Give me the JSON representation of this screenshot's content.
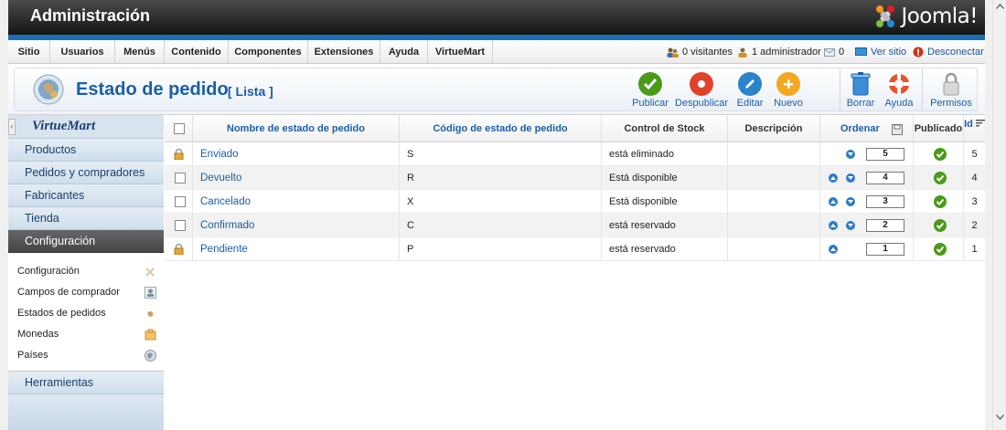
{
  "header": {
    "title": "Administración",
    "brand": "Joomla!",
    "brand_icon": "joomla-logo-icon"
  },
  "menu": {
    "items": [
      "Sitio",
      "Usuarios",
      "Menús",
      "Contenido",
      "Componentes",
      "Extensiones",
      "Ayuda",
      "VirtueMart"
    ]
  },
  "status": {
    "visitors": "0 visitantes",
    "admins": "1 administrador",
    "messages": "0",
    "view_site": "Ver sitio",
    "logout": "Desconectar"
  },
  "page": {
    "title": "Estado de pedido",
    "subtitle": "[ Lista ]"
  },
  "toolbar": {
    "publish": "Publicar",
    "unpublish": "Despublicar",
    "edit": "Editar",
    "new": "Nuevo",
    "delete": "Borrar",
    "help": "Ayuda",
    "permissions": "Permisos"
  },
  "sidebar": {
    "logo_text": "VirtueMart",
    "categories": [
      "Productos",
      "Pedidos y compradores",
      "Fabricantes",
      "Tienda",
      "Configuración"
    ],
    "active_category": "Configuración",
    "subitems": [
      {
        "label": "Configuración",
        "icon": "tools-icon"
      },
      {
        "label": "Campos de comprador",
        "icon": "user-fields-icon"
      },
      {
        "label": "Estados de pedidos",
        "icon": "order-status-icon"
      },
      {
        "label": "Monedas",
        "icon": "currency-icon"
      },
      {
        "label": "Países",
        "icon": "globe-icon"
      }
    ],
    "tools": "Herramientas"
  },
  "table": {
    "headers": {
      "name": "Nombre de estado de pedido",
      "code": "Código de estado de pedido",
      "stock": "Control de Stock",
      "description": "Descripción",
      "order": "Ordenar",
      "published": "Publicado",
      "id": "Id"
    },
    "rows": [
      {
        "name": "Enviado",
        "code": "S",
        "stock": "está eliminado",
        "order": "5",
        "id": "5",
        "locked": true,
        "up": false,
        "down": true
      },
      {
        "name": "Devuelto",
        "code": "R",
        "stock": "Está disponible",
        "order": "4",
        "id": "4",
        "locked": false,
        "up": true,
        "down": true
      },
      {
        "name": "Cancelado",
        "code": "X",
        "stock": "Está disponible",
        "order": "3",
        "id": "3",
        "locked": false,
        "up": true,
        "down": true
      },
      {
        "name": "Confirmado",
        "code": "C",
        "stock": "está reservado",
        "order": "2",
        "id": "2",
        "locked": false,
        "up": true,
        "down": true
      },
      {
        "name": "Pendiente",
        "code": "P",
        "stock": "está reservado",
        "order": "1",
        "id": "1",
        "locked": true,
        "up": true,
        "down": false
      }
    ]
  },
  "colors": {
    "header_dark": "#151515",
    "accent_blue": "#1a6fb5",
    "link_blue": "#1b5ea8",
    "publish_green": "#4a9b19",
    "unpublish_red": "#e0432b",
    "edit_blue": "#2a84c9",
    "new_orange": "#f5a623"
  }
}
